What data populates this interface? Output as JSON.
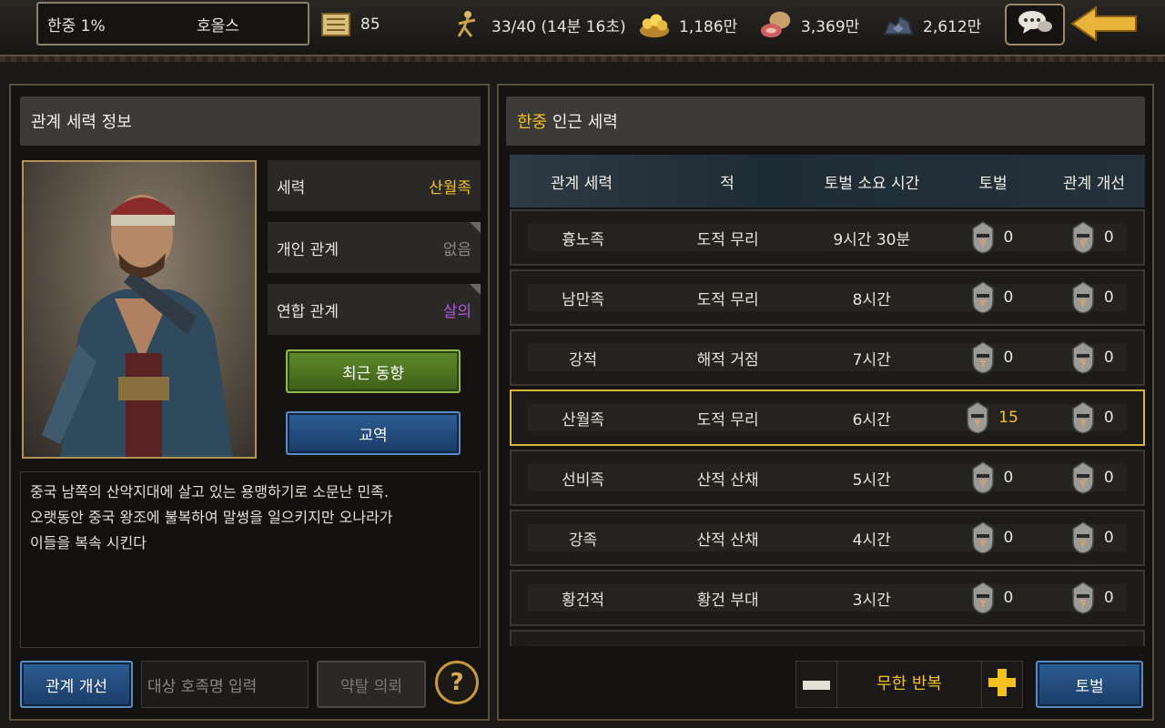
{
  "topbar": {
    "city": "한중 1%",
    "lord": "호올스",
    "resources": [
      {
        "icon": "scroll-icon",
        "value": "85"
      },
      {
        "icon": "soldier-stamina-icon",
        "value": "33/40 (14분 16초)"
      },
      {
        "icon": "gold-icon",
        "value": "1,186만"
      },
      {
        "icon": "food-icon",
        "value": "3,369만"
      },
      {
        "icon": "iron-ore-icon",
        "value": "2,612만"
      }
    ]
  },
  "left": {
    "title": "관계 세력 정보",
    "rows": [
      {
        "label": "세력",
        "value": "산월족",
        "color": "#f2c21a"
      },
      {
        "label": "개인 관계",
        "value": "없음",
        "color": "#8b877e"
      },
      {
        "label": "연합 관계",
        "value": "살의",
        "color": "#b05ad8"
      }
    ],
    "recent_btn": "최근 동향",
    "trade_btn": "교역",
    "description": "중국 남쪽의 산악지대에 살고 있는 용맹하기로 소문난 민족.\n오랫동안 중국 왕조에 불복하여 말썽을 일으키지만 오나라가\n이들을 복속 시킨다",
    "improve_btn": "관계 개선",
    "target_placeholder": "대상 호족명 입력",
    "plunder_btn": "약탈 의뢰",
    "help": "?"
  },
  "right": {
    "title_accent": "한중",
    "title_rest": " 인근 세력",
    "headers": [
      "관계 세력",
      "적",
      "토벌 소요 시간",
      "토벌",
      "관계 개선"
    ],
    "rows": [
      {
        "faction": "흉노족",
        "enemy": "도적 무리",
        "time": "9시간 30분",
        "subjugate": "0",
        "improve": "0",
        "selected": false
      },
      {
        "faction": "남만족",
        "enemy": "도적 무리",
        "time": "8시간",
        "subjugate": "0",
        "improve": "0",
        "selected": false
      },
      {
        "faction": "강적",
        "enemy": "해적 거점",
        "time": "7시간",
        "subjugate": "0",
        "improve": "0",
        "selected": false
      },
      {
        "faction": "산월족",
        "enemy": "도적 무리",
        "time": "6시간",
        "subjugate": "15",
        "improve": "0",
        "selected": true
      },
      {
        "faction": "선비족",
        "enemy": "산적 산채",
        "time": "5시간",
        "subjugate": "0",
        "improve": "0",
        "selected": false
      },
      {
        "faction": "강족",
        "enemy": "산적 산채",
        "time": "4시간",
        "subjugate": "0",
        "improve": "0",
        "selected": false
      },
      {
        "faction": "황건적",
        "enemy": "황건 부대",
        "time": "3시간",
        "subjugate": "0",
        "improve": "0",
        "selected": false
      }
    ],
    "repeat_label": "무한 반복",
    "subjugate_btn": "토벌"
  }
}
